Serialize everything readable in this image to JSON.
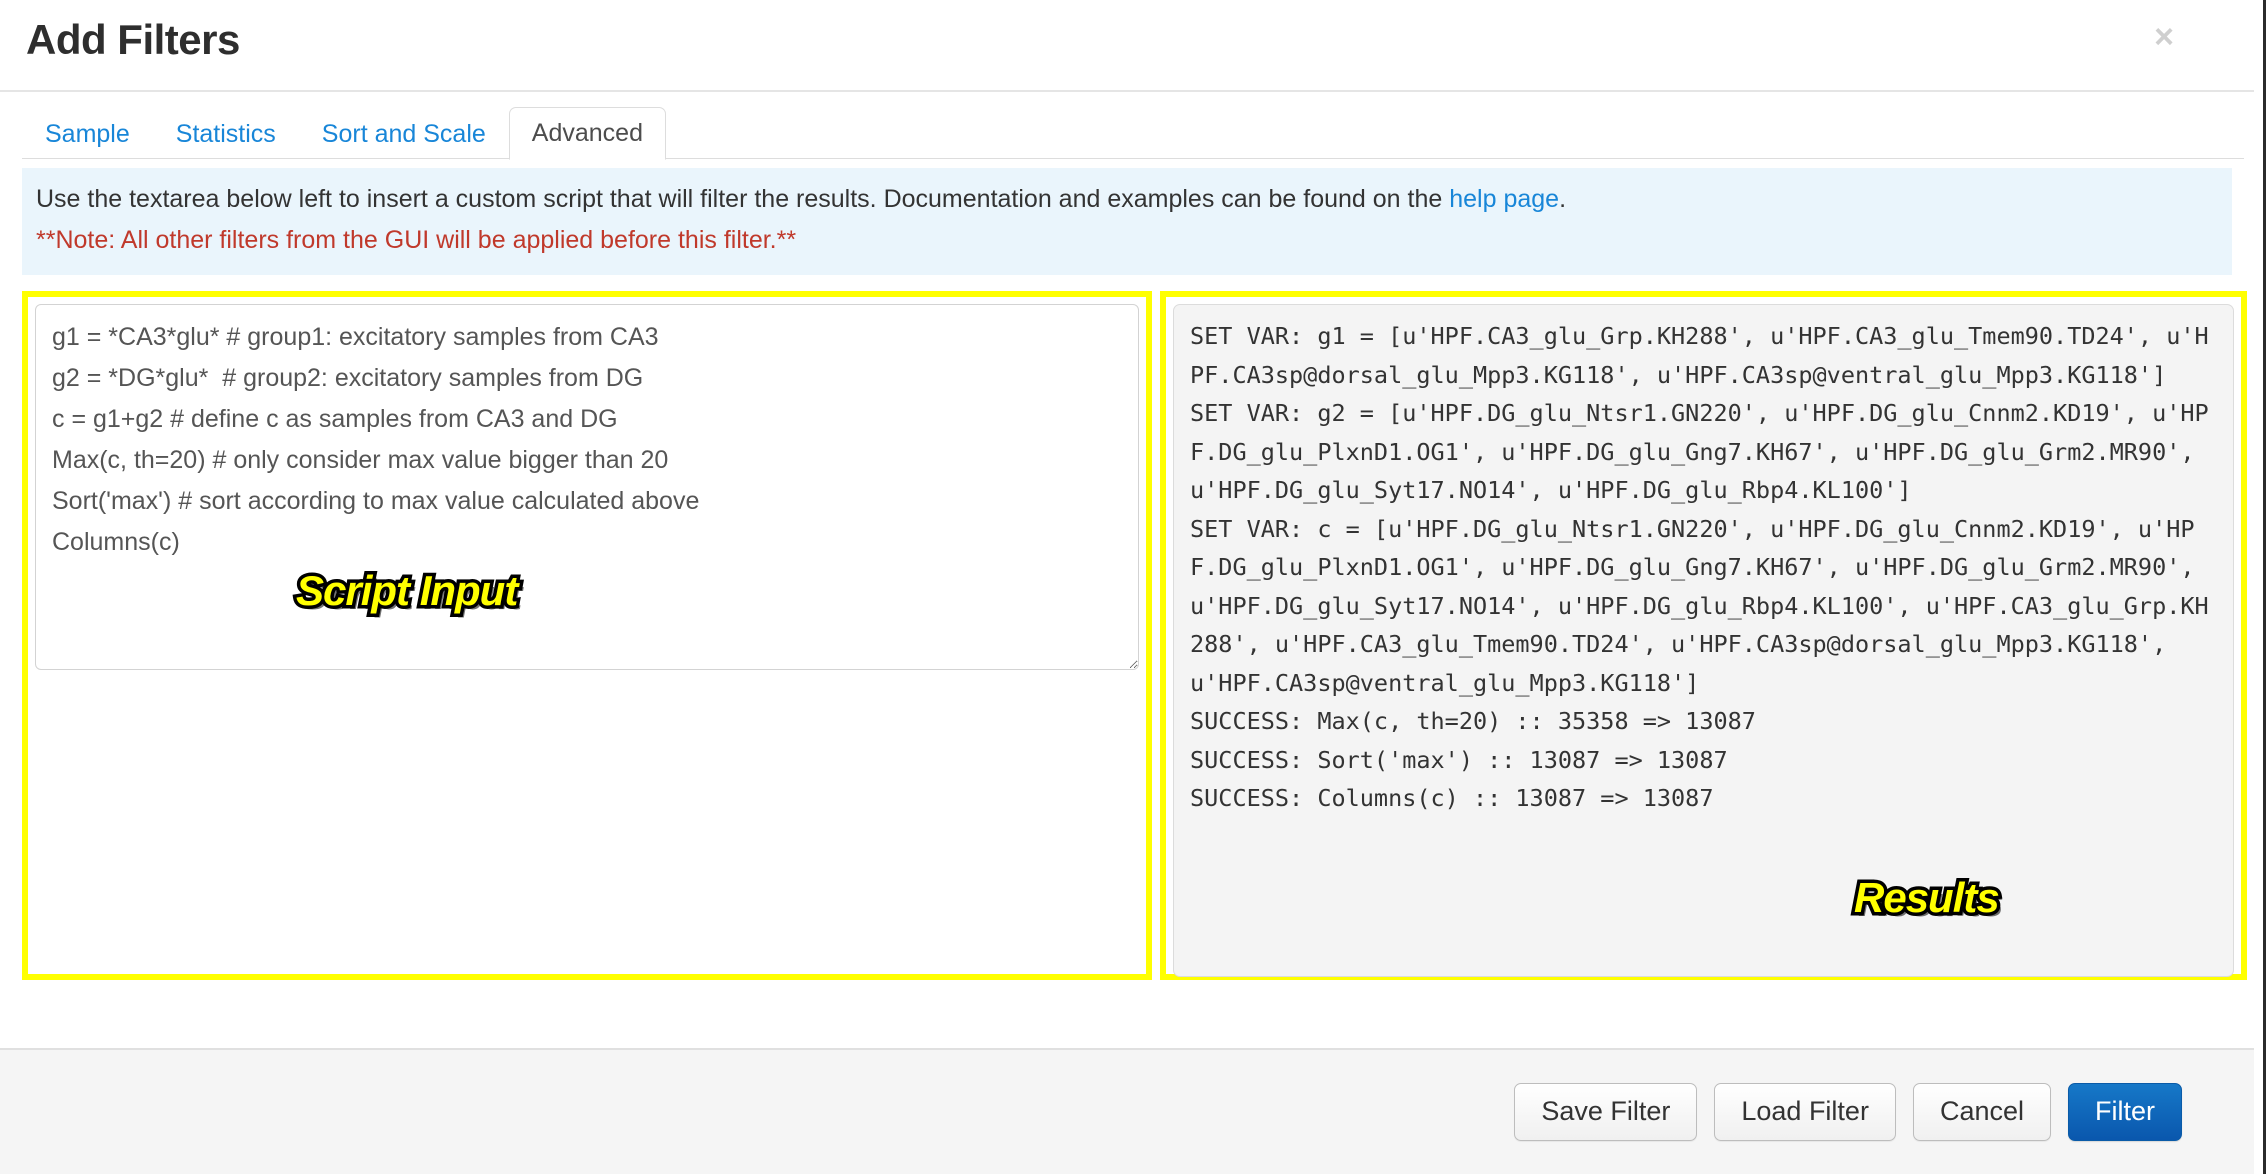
{
  "window": {
    "title": "Add Filters",
    "close_icon": "close-icon",
    "close_glyph": "×"
  },
  "tabs": [
    {
      "label": "Sample",
      "active": false
    },
    {
      "label": "Statistics",
      "active": false
    },
    {
      "label": "Sort and Scale",
      "active": false
    },
    {
      "label": "Advanced",
      "active": true
    }
  ],
  "info_bar": {
    "text_before_link": "Use the textarea below left to insert a custom script that will filter the results. Documentation and examples can be found on the ",
    "link_text": "help page",
    "text_after_link": ".",
    "note": "**Note: All other filters from the GUI will be applied before this filter.**",
    "note_color": "#c0392b",
    "background_color": "#eaf5fc",
    "link_color": "#1886d8"
  },
  "script_panel": {
    "annotation_label": "Script Input",
    "annotation_color": "#ffff00",
    "value": "g1 = *CA3*glu* # group1: excitatory samples from CA3\ng2 = *DG*glu*  # group2: excitatory samples from DG\nc = g1+g2 # define c as samples from CA3 and DG\nMax(c, th=20) # only consider max value bigger than 20\nSort('max') # sort according to max value calculated above\nColumns(c)",
    "placeholder": ""
  },
  "results_panel": {
    "annotation_label": "Results",
    "annotation_color": "#ffff00",
    "text": "SET VAR: g1 = [u'HPF.CA3_glu_Grp.KH288', u'HPF.CA3_glu_Tmem90.TD24', u'HPF.CA3sp@dorsal_glu_Mpp3.KG118', u'HPF.CA3sp@ventral_glu_Mpp3.KG118']\nSET VAR: g2 = [u'HPF.DG_glu_Ntsr1.GN220', u'HPF.DG_glu_Cnnm2.KD19', u'HPF.DG_glu_PlxnD1.OG1', u'HPF.DG_glu_Gng7.KH67', u'HPF.DG_glu_Grm2.MR90', u'HPF.DG_glu_Syt17.NO14', u'HPF.DG_glu_Rbp4.KL100']\nSET VAR: c = [u'HPF.DG_glu_Ntsr1.GN220', u'HPF.DG_glu_Cnnm2.KD19', u'HPF.DG_glu_PlxnD1.OG1', u'HPF.DG_glu_Gng7.KH67', u'HPF.DG_glu_Grm2.MR90', u'HPF.DG_glu_Syt17.NO14', u'HPF.DG_glu_Rbp4.KL100', u'HPF.CA3_glu_Grp.KH288', u'HPF.CA3_glu_Tmem90.TD24', u'HPF.CA3sp@dorsal_glu_Mpp3.KG118', u'HPF.CA3sp@ventral_glu_Mpp3.KG118']\nSUCCESS: Max(c, th=20) :: 35358 => 13087\nSUCCESS: Sort('max') :: 13087 => 13087\nSUCCESS: Columns(c) :: 13087 => 13087"
  },
  "footer": {
    "buttons": [
      {
        "label": "Save Filter",
        "style": "default"
      },
      {
        "label": "Load Filter",
        "style": "default"
      },
      {
        "label": "Cancel",
        "style": "default"
      },
      {
        "label": "Filter",
        "style": "primary"
      }
    ],
    "primary_color": "#0a57ad"
  }
}
